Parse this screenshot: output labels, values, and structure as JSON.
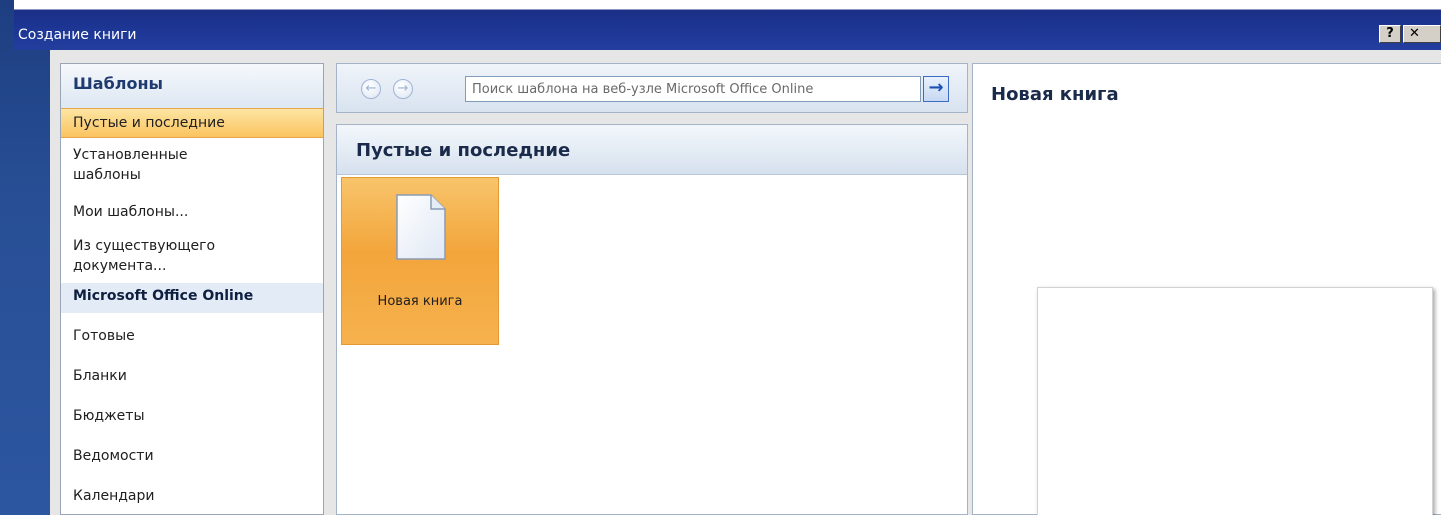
{
  "window": {
    "title": "Создание книги",
    "help_label": "?",
    "close_label": "✕"
  },
  "sidebar": {
    "header": "Шаблоны",
    "items": [
      {
        "label": "Пустые и последние"
      },
      {
        "label": "Установленные шаблоны"
      },
      {
        "label": "Мои шаблоны..."
      },
      {
        "label": "Из существующего документа..."
      },
      {
        "label": "Microsoft Office Online"
      },
      {
        "label": "Готовые"
      },
      {
        "label": "Бланки"
      },
      {
        "label": "Бюджеты"
      },
      {
        "label": "Ведомости"
      },
      {
        "label": "Календари"
      }
    ],
    "selected_index": 0
  },
  "navbar": {
    "back_icon": "←",
    "forward_icon": "→",
    "search_value": "Поиск шаблона на веб-узле Microsoft Office Online",
    "go_icon": "→"
  },
  "main": {
    "header": "Пустые и последние",
    "tiles": [
      {
        "label": "Новая книга",
        "icon": "blank-document-icon"
      }
    ]
  },
  "preview": {
    "title": "Новая книга"
  },
  "colors": {
    "selection": "#fbc460",
    "tile_orange": "#f3a53b",
    "title_bar": "#1d3593",
    "header_text": "#1a2a4a"
  }
}
